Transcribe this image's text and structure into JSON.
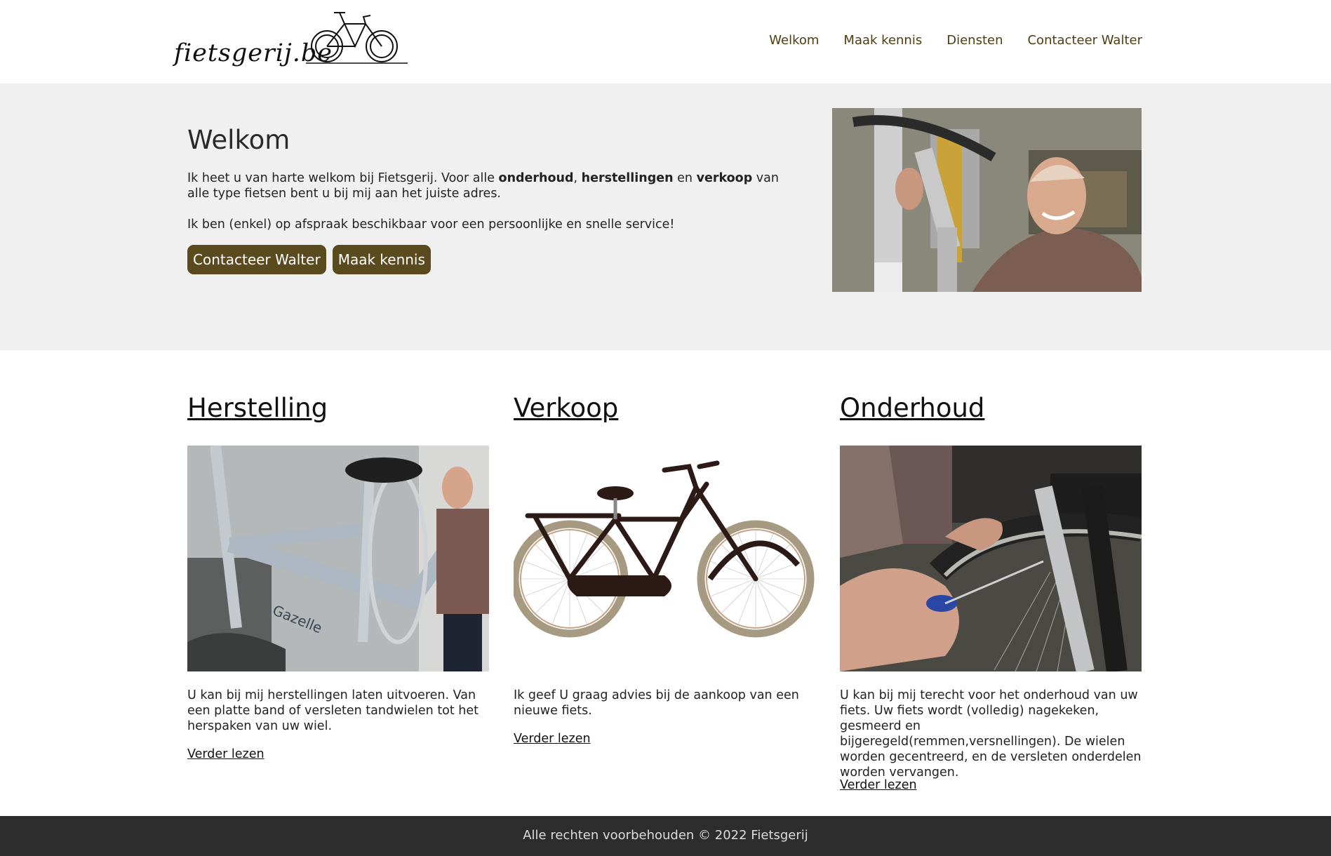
{
  "header": {
    "logo_text": "fietsgerij.be",
    "nav": [
      "Welkom",
      "Maak kennis",
      "Diensten",
      "Contacteer Walter"
    ]
  },
  "hero": {
    "title": "Welkom",
    "p1_a": "Ik heet u van harte welkom bij Fietsgerij. Voor alle ",
    "p1_b": "onderhoud",
    "p1_c": ", ",
    "p1_d": "herstellingen",
    "p1_e": " en ",
    "p1_f": "verkoop",
    "p1_g": " van alle type fietsen bent u bij mij aan het juiste adres.",
    "p2": "Ik ben (enkel) op afspraak beschikbaar voor een persoonlijke en snelle service!",
    "btn_contact": "Contacteer Walter",
    "btn_meet": "Maak kennis"
  },
  "cards": [
    {
      "title": "Herstelling",
      "text": "U kan bij mij herstellingen laten uitvoeren. Van een platte band of versleten tandwielen tot het herspaken van uw wiel.",
      "link": "Verder lezen"
    },
    {
      "title": "Verkoop",
      "text": "Ik geef U graag advies bij de aankoop van een nieuwe fiets.",
      "link": "Verder lezen"
    },
    {
      "title": "Onderhoud",
      "text": "U kan bij mij terecht voor het onderhoud van uw fiets. Uw fiets wordt (volledig) nagekeken, gesmeerd en bijgeregeld(remmen,versnellingen). De wielen worden gecentreerd, en de versleten onderdelen worden vervangen.",
      "link": "Verder lezen"
    }
  ],
  "footer": {
    "text": "Alle rechten voorbehouden © 2022 Fietsgerij"
  },
  "colors": {
    "accent": "#5a4a1e",
    "nav_text": "#4f3d12",
    "hero_bg": "#f0f0f0",
    "footer_bg": "#2d2d2d"
  }
}
